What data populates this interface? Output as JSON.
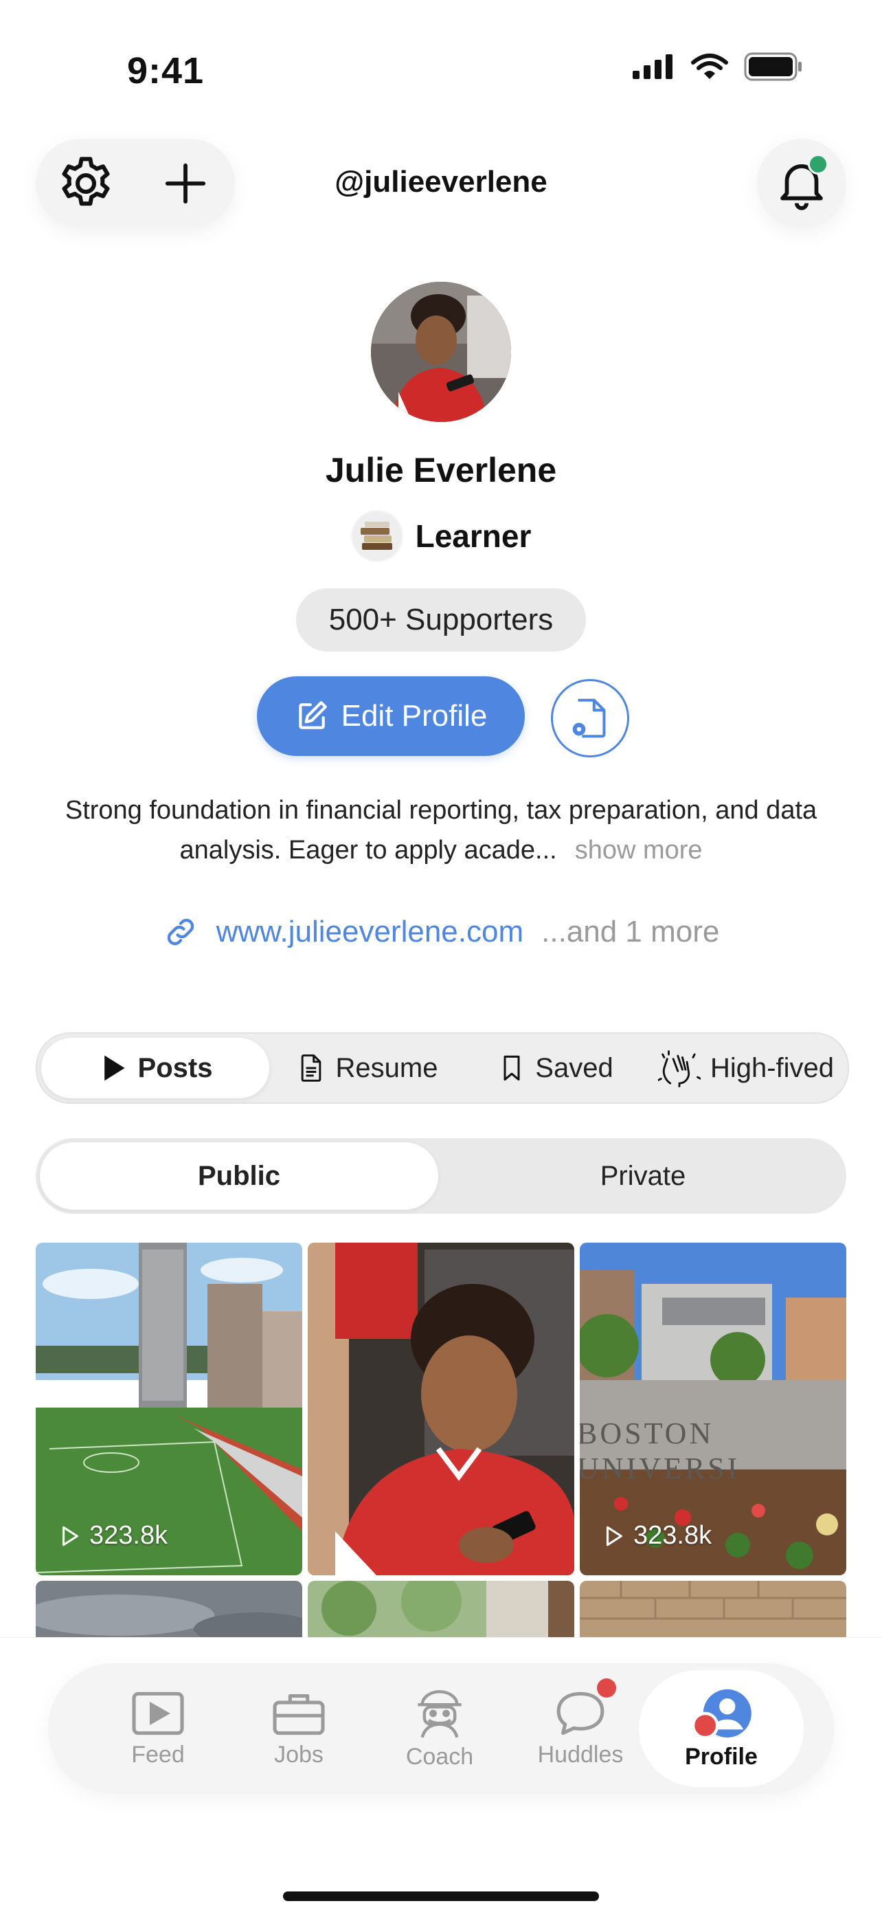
{
  "status_bar": {
    "time": "9:41"
  },
  "header": {
    "handle": "@julieeverlene"
  },
  "profile": {
    "name": "Julie Everlene",
    "role": "Learner",
    "supporters": "500+ Supporters",
    "edit_label": "Edit Profile",
    "bio": "Strong foundation in financial reporting, tax preparation, and data analysis. Eager to apply acade...",
    "show_more": "show more",
    "link": "www.julieeverlene.com",
    "link_more": "...and 1 more"
  },
  "tabs": [
    {
      "label": "Posts",
      "icon": "play-icon",
      "active": true
    },
    {
      "label": "Resume",
      "icon": "document-icon"
    },
    {
      "label": "Saved",
      "icon": "bookmark-icon"
    },
    {
      "label": "High-fived",
      "icon": "clap-icon"
    }
  ],
  "segments": [
    {
      "label": "Public",
      "active": true
    },
    {
      "label": "Private"
    }
  ],
  "posts": [
    {
      "views": "323.8k",
      "scene": "stadium-city"
    },
    {
      "views": "",
      "scene": "woman-phone"
    },
    {
      "views": "323.8k",
      "scene": "boston-university-sign"
    },
    {
      "views": "",
      "scene": "sky"
    },
    {
      "views": "",
      "scene": "trees"
    },
    {
      "views": "",
      "scene": "brick"
    }
  ],
  "nav": [
    {
      "label": "Feed",
      "icon": "video-icon"
    },
    {
      "label": "Jobs",
      "icon": "briefcase-icon"
    },
    {
      "label": "Coach",
      "icon": "coach-icon"
    },
    {
      "label": "Huddles",
      "icon": "chat-bubble-icon"
    },
    {
      "label": "Profile",
      "icon": "profile-icon",
      "active": true
    }
  ],
  "colors": {
    "accent": "#4f86e0",
    "notification_dot": "#2ea36b",
    "badge_red": "#e04848"
  }
}
